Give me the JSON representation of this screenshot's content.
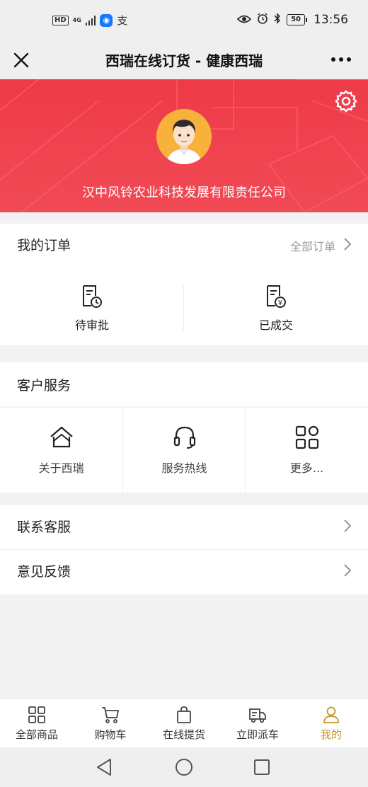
{
  "status_bar": {
    "hd": "HD",
    "network": "4G",
    "app_icon_1": "info-app-icon",
    "app_icon_2": "支",
    "battery": "50",
    "time": "13:56"
  },
  "title_bar": {
    "title": "西瑞在线订货 - 健康西瑞",
    "close_icon": "close-icon",
    "more_icon": "more-dots-icon"
  },
  "banner": {
    "company_name": "汉中风铃农业科技发展有限责任公司",
    "settings_icon": "gear-icon",
    "avatar": "avatar-cartoon-man",
    "color": "#ef3a48"
  },
  "orders": {
    "title": "我的订单",
    "all_orders": "全部订单",
    "items": [
      {
        "label": "待审批",
        "icon": "document-clock-icon"
      },
      {
        "label": "已成交",
        "icon": "document-yen-icon"
      }
    ]
  },
  "service": {
    "title": "客户服务",
    "items": [
      {
        "label": "关于西瑞",
        "icon": "home-icon"
      },
      {
        "label": "服务热线",
        "icon": "headset-icon"
      },
      {
        "label": "更多...",
        "icon": "grid-icon"
      }
    ]
  },
  "links": [
    {
      "label": "联系客服"
    },
    {
      "label": "意见反馈"
    }
  ],
  "tabbar": {
    "active_color": "#c8922a",
    "items": [
      {
        "label": "全部商品",
        "icon": "grid-icon"
      },
      {
        "label": "购物车",
        "icon": "cart-icon"
      },
      {
        "label": "在线提货",
        "icon": "bag-icon"
      },
      {
        "label": "立即派车",
        "icon": "truck-icon"
      },
      {
        "label": "我的",
        "icon": "user-icon"
      }
    ]
  },
  "nav": {
    "back": "back-triangle-icon",
    "home": "home-circle-icon",
    "recents": "recents-square-icon"
  }
}
